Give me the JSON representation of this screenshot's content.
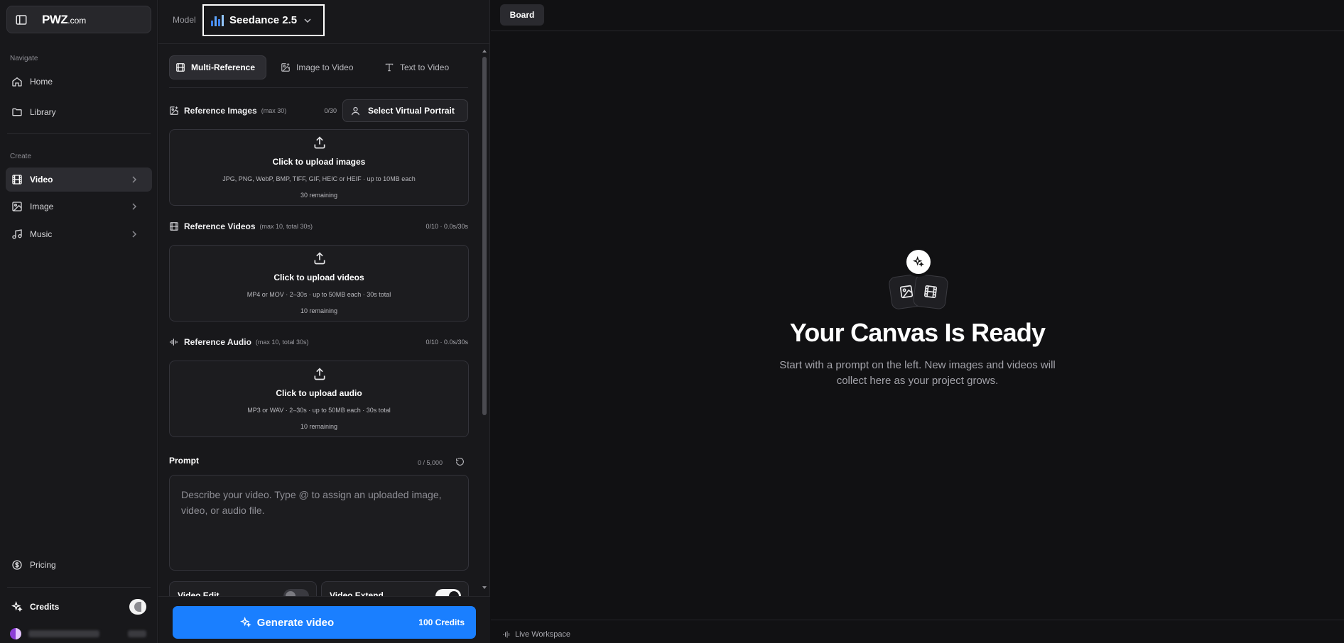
{
  "brand": {
    "name": "PWZ",
    "suffix": ".com"
  },
  "nav": {
    "navigate_label": "Navigate",
    "create_label": "Create",
    "items": [
      {
        "label": "Home",
        "icon": "home-icon"
      },
      {
        "label": "Library",
        "icon": "folder-icon"
      },
      {
        "label": "Video",
        "icon": "film-icon",
        "active": true
      },
      {
        "label": "Image",
        "icon": "image-icon"
      },
      {
        "label": "Music",
        "icon": "music-icon"
      }
    ],
    "pricing": "Pricing",
    "credits": "Credits"
  },
  "model": {
    "label": "Model",
    "name": "Seedance 2.5",
    "accent": "#3b82f6"
  },
  "tabs": [
    {
      "label": "Multi-Reference",
      "active": true
    },
    {
      "label": "Image to Video"
    },
    {
      "label": "Text to Video"
    }
  ],
  "sections": {
    "images": {
      "title": "Reference Images",
      "note": "(max 30)",
      "count": "0/30",
      "portrait_button": "Select Virtual Portrait",
      "upload": "Click to upload images",
      "formats": "JPG, PNG, WebP, BMP, TIFF, GIF, HEIC or HEIF · up to 10MB each",
      "remaining": "30 remaining"
    },
    "videos": {
      "title": "Reference Videos",
      "note": "(max 10, total 30s)",
      "count": "0/10 · 0.0s/30s",
      "upload": "Click to upload videos",
      "formats": "MP4 or MOV · 2–30s · up to 50MB each · 30s total",
      "remaining": "10 remaining"
    },
    "audio": {
      "title": "Reference Audio",
      "note": "(max 10, total 30s)",
      "count": "0/10 · 0.0s/30s",
      "upload": "Click to upload audio",
      "formats": "MP3 or WAV · 2–30s · up to 50MB each · 30s total",
      "remaining": "10 remaining"
    }
  },
  "prompt": {
    "title": "Prompt",
    "count": "0 / 5,000",
    "placeholder": "Describe your video. Type @ to assign an uploaded image, video, or audio file."
  },
  "options": [
    {
      "label": "Video Edit",
      "enabled": false
    },
    {
      "label": "Video Extend",
      "enabled": true
    }
  ],
  "generate": {
    "label": "Generate video",
    "credits": "100 Credits",
    "color": "#1a7fff"
  },
  "canvas": {
    "board_button": "Board",
    "title": "Your Canvas Is Ready",
    "subtitle": "Start with a prompt on the left. New images and videos will collect here as your project grows.",
    "footer": "Live Workspace"
  }
}
